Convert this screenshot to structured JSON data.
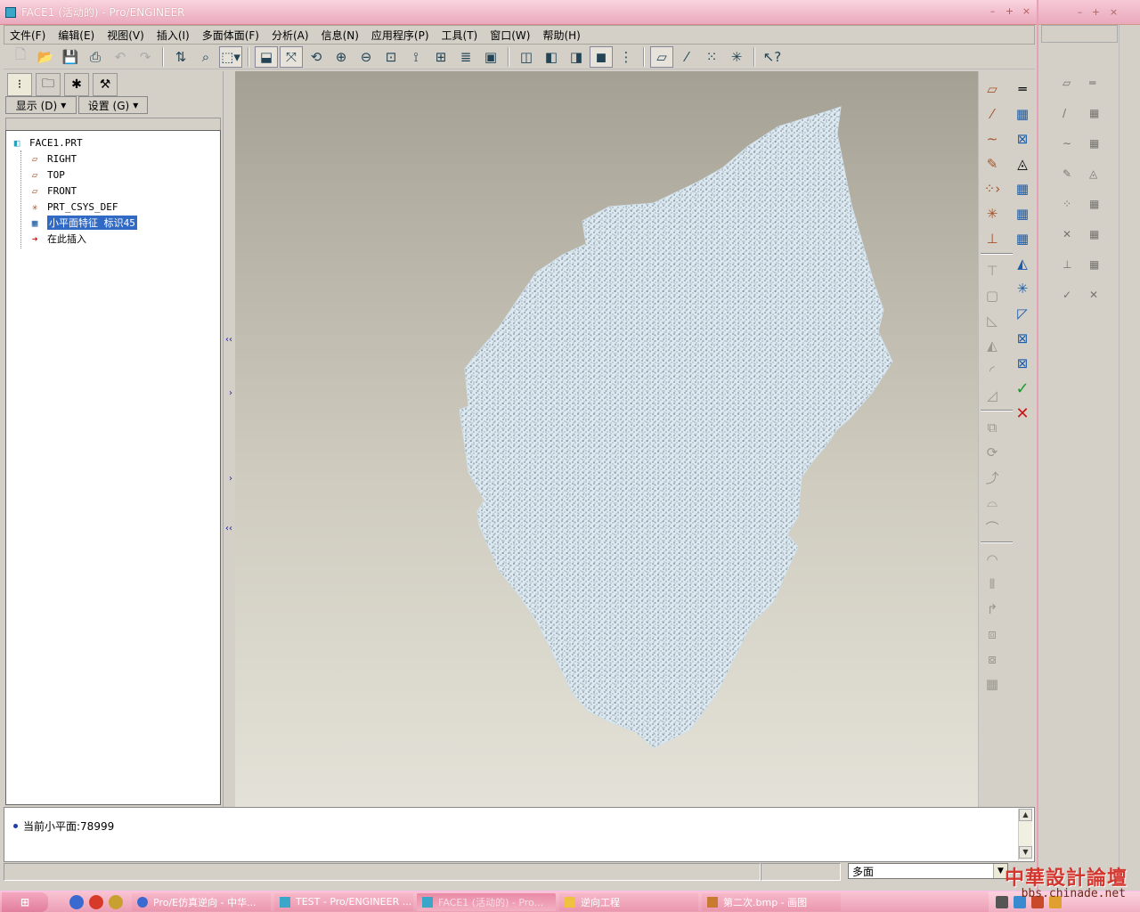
{
  "window": {
    "title": "FACE1 (活动的) - Pro/ENGINEER"
  },
  "menu": [
    "文件(F)",
    "编辑(E)",
    "视图(V)",
    "插入(I)",
    "多面体面(F)",
    "分析(A)",
    "信息(N)",
    "应用程序(P)",
    "工具(T)",
    "窗口(W)",
    "帮助(H)"
  ],
  "navigator": {
    "show_label": "显示 (D)",
    "settings_label": "设置 (G)",
    "tree": {
      "root": "FACE1.PRT",
      "items": [
        {
          "label": "RIGHT",
          "icon": "datum-plane-icon"
        },
        {
          "label": "TOP",
          "icon": "datum-plane-icon"
        },
        {
          "label": "FRONT",
          "icon": "datum-plane-icon"
        },
        {
          "label": "PRT_CSYS_DEF",
          "icon": "csys-icon"
        },
        {
          "label": "小平面特征 标识45",
          "icon": "facet-feature-icon",
          "selected": true
        },
        {
          "label": "在此插入",
          "icon": "insert-here-arrow-icon"
        }
      ]
    }
  },
  "message": {
    "text": "当前小平面:78999"
  },
  "status": {
    "filter_value": "多面"
  },
  "taskbar": {
    "tasks": [
      {
        "label": "Pro/E仿真逆向 - 中华...",
        "active": false
      },
      {
        "label": "TEST - Pro/ENGINEER ...",
        "active": false
      },
      {
        "label": "FACE1 (活动的) - Pro...",
        "active": true
      },
      {
        "label": "逆向工程",
        "active": false
      },
      {
        "label": "第二次.bmp - 画图",
        "active": false
      }
    ]
  },
  "watermark": {
    "text": "中華設計論壇",
    "url": "bbs.chinade.net"
  },
  "colors": {
    "title_bar": "#eaa9bd",
    "viewport_top": "#a4a093",
    "viewport_bottom": "#e4e2d8",
    "mesh_fill": "#dbe9f2",
    "selection": "#316ac5"
  }
}
